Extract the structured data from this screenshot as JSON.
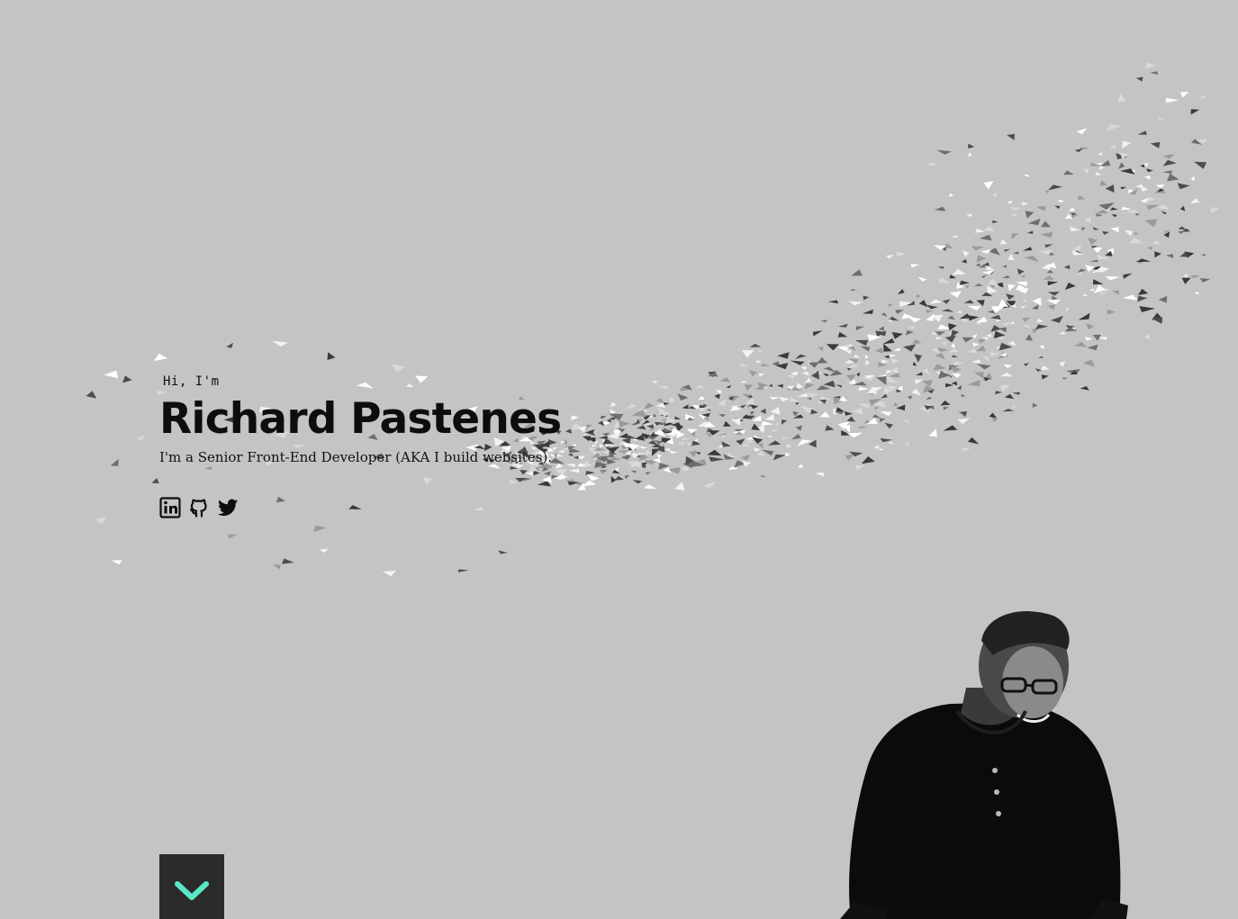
{
  "hero": {
    "greeting": "Hi, I'm",
    "name": "Richard Pastenes",
    "tagline": "I'm a Senior Front-End Developer (AKA I build websites)."
  },
  "socials": [
    {
      "network": "LinkedIn",
      "icon": "linkedin-icon"
    },
    {
      "network": "GitHub",
      "icon": "github-icon"
    },
    {
      "network": "Twitter",
      "icon": "twitter-icon"
    }
  ],
  "scroll_button": {
    "icon": "chevron-down-icon"
  },
  "colors": {
    "background": "#c4c4c4",
    "text": "#0d0d0d",
    "button_bg": "#2b2b2b",
    "accent": "#5ce8c8"
  }
}
